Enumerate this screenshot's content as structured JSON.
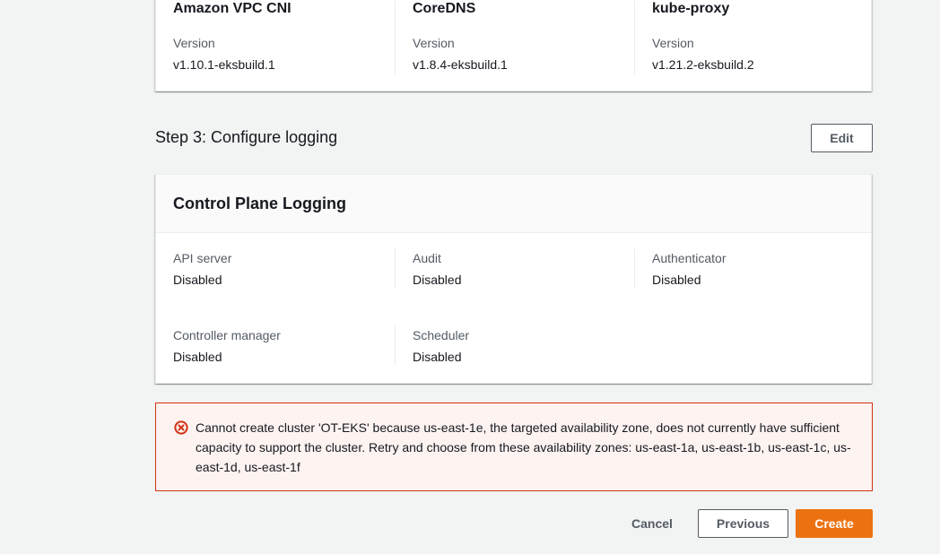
{
  "addons": [
    {
      "name": "Amazon VPC CNI",
      "version_label": "Version",
      "version": "v1.10.1-eksbuild.1"
    },
    {
      "name": "CoreDNS",
      "version_label": "Version",
      "version": "v1.8.4-eksbuild.1"
    },
    {
      "name": "kube-proxy",
      "version_label": "Version",
      "version": "v1.21.2-eksbuild.2"
    }
  ],
  "step3": {
    "title": "Step 3: Configure logging",
    "edit_label": "Edit"
  },
  "logging": {
    "title": "Control Plane Logging",
    "items": [
      {
        "label": "API server",
        "value": "Disabled"
      },
      {
        "label": "Audit",
        "value": "Disabled"
      },
      {
        "label": "Authenticator",
        "value": "Disabled"
      },
      {
        "label": "Controller manager",
        "value": "Disabled"
      },
      {
        "label": "Scheduler",
        "value": "Disabled"
      }
    ]
  },
  "alert": {
    "message": "Cannot create cluster 'OT-EKS' because us-east-1e, the targeted availability zone, does not currently have sufficient capacity to support the cluster. Retry and choose from these availability zones: us-east-1a, us-east-1b, us-east-1c, us-east-1d, us-east-1f",
    "icon": "error-circle-icon",
    "color": "#d13212"
  },
  "footer": {
    "cancel_label": "Cancel",
    "previous_label": "Previous",
    "create_label": "Create"
  },
  "colors": {
    "primary": "#ec7211",
    "background": "#f2f3f3",
    "error_border": "#d13212",
    "error_bg": "#fdf3f1"
  }
}
